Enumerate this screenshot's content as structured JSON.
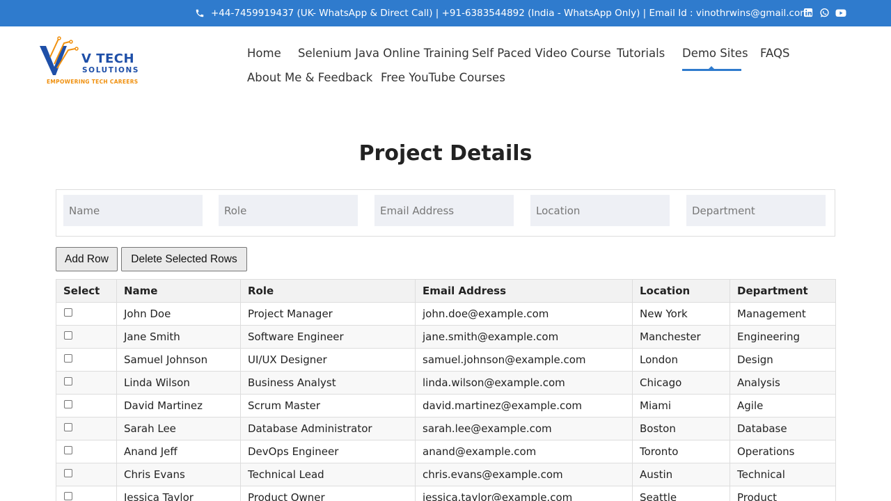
{
  "topbar": {
    "contact_text": "+44-7459919437 (UK- WhatsApp & Direct Call) | +91-6383544892 (India - WhatsApp Only) | Email Id : vinothrwins@gmail.com",
    "icons": [
      "phone-icon",
      "linkedin-icon",
      "whatsapp-icon",
      "youtube-icon"
    ],
    "background": "#2f7bcd"
  },
  "logo": {
    "brand": "V TECH",
    "sub": "SOLUTIONS",
    "tagline": "EMPOWERING TECH CAREERS",
    "colors": {
      "blue": "#1e4fa8",
      "orange": "#f0900e"
    }
  },
  "nav": {
    "items": [
      "Home",
      "Selenium Java Online Training",
      "Self Paced Video Course",
      "Tutorials",
      "Demo Sites",
      "FAQS",
      "About Me & Feedback",
      "Free YouTube Courses"
    ],
    "active": "Demo Sites",
    "accent": "#2f7bcd"
  },
  "page": {
    "title": "Project Details"
  },
  "form": {
    "placeholders": {
      "name": "Name",
      "role": "Role",
      "email": "Email Address",
      "location": "Location",
      "department": "Department"
    }
  },
  "buttons": {
    "add": "Add Row",
    "delete": "Delete Selected Rows"
  },
  "table": {
    "headers": [
      "Select",
      "Name",
      "Role",
      "Email Address",
      "Location",
      "Department"
    ],
    "rows": [
      [
        "John Doe",
        "Project Manager",
        "john.doe@example.com",
        "New York",
        "Management"
      ],
      [
        "Jane Smith",
        "Software Engineer",
        "jane.smith@example.com",
        "Manchester",
        "Engineering"
      ],
      [
        "Samuel Johnson",
        "UI/UX Designer",
        "samuel.johnson@example.com",
        "London",
        "Design"
      ],
      [
        "Linda Wilson",
        "Business Analyst",
        "linda.wilson@example.com",
        "Chicago",
        "Analysis"
      ],
      [
        "David Martinez",
        "Scrum Master",
        "david.martinez@example.com",
        "Miami",
        "Agile"
      ],
      [
        "Sarah Lee",
        "Database Administrator",
        "sarah.lee@example.com",
        "Boston",
        "Database"
      ],
      [
        "Anand Jeff",
        "DevOps Engineer",
        "anand@example.com",
        "Toronto",
        "Operations"
      ],
      [
        "Chris Evans",
        "Technical Lead",
        "chris.evans@example.com",
        "Austin",
        "Technical"
      ],
      [
        "Jessica Taylor",
        "Product Owner",
        "jessica.taylor@example.com",
        "Seattle",
        "Product"
      ]
    ]
  }
}
